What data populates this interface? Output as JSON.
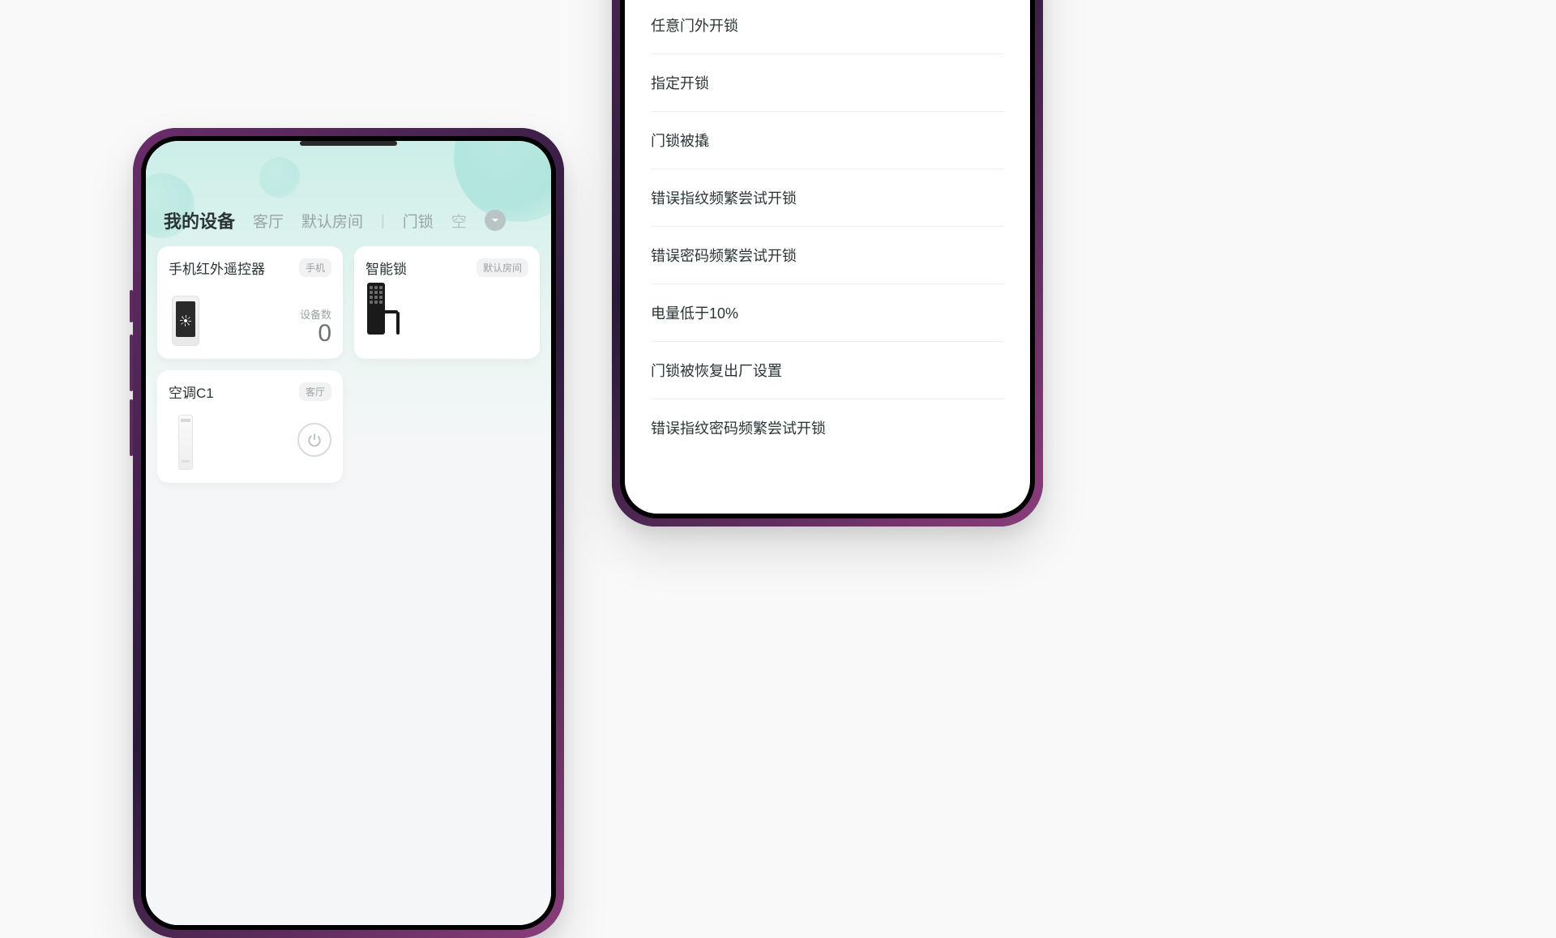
{
  "phone1": {
    "tabs": {
      "my_devices": "我的设备",
      "living_room": "客厅",
      "default_room": "默认房间",
      "door_lock": "门锁",
      "partial": "空"
    },
    "cards": [
      {
        "title": "手机红外遥控器",
        "tag": "手机",
        "count_label": "设备数",
        "count_value": "0"
      },
      {
        "title": "智能锁",
        "tag": "默认房间"
      },
      {
        "title": "空调C1",
        "tag": "客厅"
      }
    ]
  },
  "phone2": {
    "list": [
      "任意门外开锁",
      "指定开锁",
      "门锁被撬",
      "错误指纹频繁尝试开锁",
      "错误密码频繁尝试开锁",
      "电量低于10%",
      "门锁被恢复出厂设置",
      "错误指纹密码频繁尝试开锁"
    ]
  }
}
